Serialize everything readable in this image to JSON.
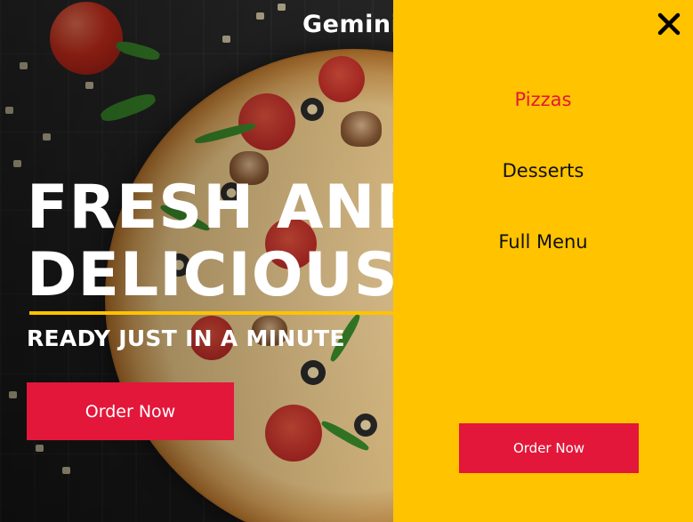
{
  "brand": {
    "name": "Gemini"
  },
  "hero": {
    "headline_line1": "FRESH AND",
    "headline_line2": "DELICIOUS",
    "subheadline": "READY JUST IN A MINUTE",
    "cta_label": "Order Now"
  },
  "menu": {
    "items": [
      {
        "label": "Pizzas",
        "active": true
      },
      {
        "label": "Desserts",
        "active": false
      },
      {
        "label": "Full Menu",
        "active": false
      }
    ],
    "cta_label": "Order Now"
  },
  "icons": {
    "close": "close-icon"
  },
  "colors": {
    "accent_yellow": "#ffc300",
    "accent_red": "#e3173a",
    "text_dark": "#111111"
  }
}
